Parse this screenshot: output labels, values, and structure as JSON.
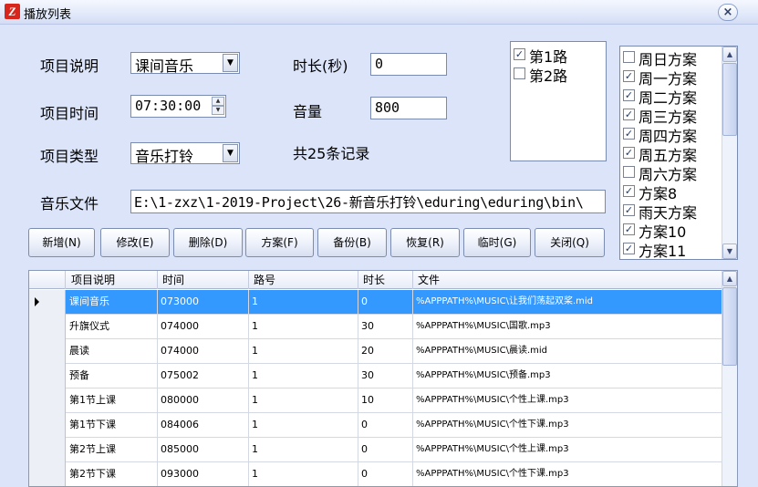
{
  "window": {
    "title": "播放列表",
    "icon_glyph": "Z",
    "close_glyph": "×"
  },
  "form": {
    "desc_label": "项目说明",
    "desc_value": "课间音乐",
    "time_label": "项目时间",
    "time_value": "07:30:00",
    "type_label": "项目类型",
    "type_value": "音乐打铃",
    "duration_label": "时长(秒)",
    "duration_value": "0",
    "volume_label": "音量",
    "volume_value": "800",
    "record_count": "共25条记录",
    "file_label": "音乐文件",
    "file_value": "E:\\1-zxz\\1-2019-Project\\26-新音乐打铃\\eduring\\eduring\\bin\\"
  },
  "routes": [
    {
      "label": "第1路",
      "checked": true
    },
    {
      "label": "第2路",
      "checked": false
    }
  ],
  "schemes": [
    {
      "label": "周日方案",
      "checked": false
    },
    {
      "label": "周一方案",
      "checked": true
    },
    {
      "label": "周二方案",
      "checked": true
    },
    {
      "label": "周三方案",
      "checked": true
    },
    {
      "label": "周四方案",
      "checked": true
    },
    {
      "label": "周五方案",
      "checked": true
    },
    {
      "label": "周六方案",
      "checked": false
    },
    {
      "label": "方案8",
      "checked": true
    },
    {
      "label": "雨天方案",
      "checked": true
    },
    {
      "label": "方案10",
      "checked": true
    },
    {
      "label": "方案11",
      "checked": true
    }
  ],
  "buttons": {
    "add": "新增(N)",
    "edit": "修改(E)",
    "delete": "删除(D)",
    "scheme": "方案(F)",
    "backup": "备份(B)",
    "restore": "恢复(R)",
    "temp": "临时(G)",
    "close": "关闭(Q)"
  },
  "grid": {
    "columns": [
      "项目说明",
      "时间",
      "路号",
      "时长",
      "文件"
    ],
    "rows": [
      [
        "课间音乐",
        "073000",
        "1",
        "0",
        "%APPPATH%\\MUSIC\\让我们荡起双桨.mid"
      ],
      [
        "升旗仪式",
        "074000",
        "1",
        "30",
        "%APPPATH%\\MUSIC\\国歌.mp3"
      ],
      [
        "晨读",
        "074000",
        "1",
        "20",
        "%APPPATH%\\MUSIC\\晨读.mid"
      ],
      [
        "预备",
        "075002",
        "1",
        "30",
        "%APPPATH%\\MUSIC\\预备.mp3"
      ],
      [
        "第1节上课",
        "080000",
        "1",
        "10",
        "%APPPATH%\\MUSIC\\个性上课.mp3"
      ],
      [
        "第1节下课",
        "084006",
        "1",
        "0",
        "%APPPATH%\\MUSIC\\个性下课.mp3"
      ],
      [
        "第2节上课",
        "085000",
        "1",
        "0",
        "%APPPATH%\\MUSIC\\个性上课.mp3"
      ],
      [
        "第2节下课",
        "093000",
        "1",
        "0",
        "%APPPATH%\\MUSIC\\个性下课.mp3"
      ]
    ],
    "selected_row": 0
  },
  "colors": {
    "background": "#dbe4f8",
    "selection": "#3399ff"
  }
}
